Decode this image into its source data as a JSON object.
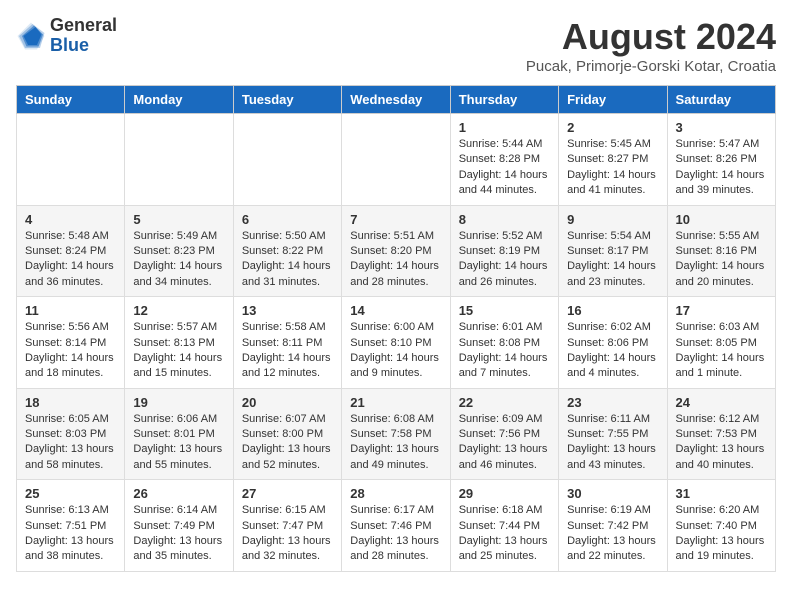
{
  "logo": {
    "general": "General",
    "blue": "Blue"
  },
  "title": "August 2024",
  "subtitle": "Pucak, Primorje-Gorski Kotar, Croatia",
  "headers": [
    "Sunday",
    "Monday",
    "Tuesday",
    "Wednesday",
    "Thursday",
    "Friday",
    "Saturday"
  ],
  "weeks": [
    [
      {
        "day": "",
        "info": ""
      },
      {
        "day": "",
        "info": ""
      },
      {
        "day": "",
        "info": ""
      },
      {
        "day": "",
        "info": ""
      },
      {
        "day": "1",
        "info": "Sunrise: 5:44 AM\nSunset: 8:28 PM\nDaylight: 14 hours and 44 minutes."
      },
      {
        "day": "2",
        "info": "Sunrise: 5:45 AM\nSunset: 8:27 PM\nDaylight: 14 hours and 41 minutes."
      },
      {
        "day": "3",
        "info": "Sunrise: 5:47 AM\nSunset: 8:26 PM\nDaylight: 14 hours and 39 minutes."
      }
    ],
    [
      {
        "day": "4",
        "info": "Sunrise: 5:48 AM\nSunset: 8:24 PM\nDaylight: 14 hours and 36 minutes."
      },
      {
        "day": "5",
        "info": "Sunrise: 5:49 AM\nSunset: 8:23 PM\nDaylight: 14 hours and 34 minutes."
      },
      {
        "day": "6",
        "info": "Sunrise: 5:50 AM\nSunset: 8:22 PM\nDaylight: 14 hours and 31 minutes."
      },
      {
        "day": "7",
        "info": "Sunrise: 5:51 AM\nSunset: 8:20 PM\nDaylight: 14 hours and 28 minutes."
      },
      {
        "day": "8",
        "info": "Sunrise: 5:52 AM\nSunset: 8:19 PM\nDaylight: 14 hours and 26 minutes."
      },
      {
        "day": "9",
        "info": "Sunrise: 5:54 AM\nSunset: 8:17 PM\nDaylight: 14 hours and 23 minutes."
      },
      {
        "day": "10",
        "info": "Sunrise: 5:55 AM\nSunset: 8:16 PM\nDaylight: 14 hours and 20 minutes."
      }
    ],
    [
      {
        "day": "11",
        "info": "Sunrise: 5:56 AM\nSunset: 8:14 PM\nDaylight: 14 hours and 18 minutes."
      },
      {
        "day": "12",
        "info": "Sunrise: 5:57 AM\nSunset: 8:13 PM\nDaylight: 14 hours and 15 minutes."
      },
      {
        "day": "13",
        "info": "Sunrise: 5:58 AM\nSunset: 8:11 PM\nDaylight: 14 hours and 12 minutes."
      },
      {
        "day": "14",
        "info": "Sunrise: 6:00 AM\nSunset: 8:10 PM\nDaylight: 14 hours and 9 minutes."
      },
      {
        "day": "15",
        "info": "Sunrise: 6:01 AM\nSunset: 8:08 PM\nDaylight: 14 hours and 7 minutes."
      },
      {
        "day": "16",
        "info": "Sunrise: 6:02 AM\nSunset: 8:06 PM\nDaylight: 14 hours and 4 minutes."
      },
      {
        "day": "17",
        "info": "Sunrise: 6:03 AM\nSunset: 8:05 PM\nDaylight: 14 hours and 1 minute."
      }
    ],
    [
      {
        "day": "18",
        "info": "Sunrise: 6:05 AM\nSunset: 8:03 PM\nDaylight: 13 hours and 58 minutes."
      },
      {
        "day": "19",
        "info": "Sunrise: 6:06 AM\nSunset: 8:01 PM\nDaylight: 13 hours and 55 minutes."
      },
      {
        "day": "20",
        "info": "Sunrise: 6:07 AM\nSunset: 8:00 PM\nDaylight: 13 hours and 52 minutes."
      },
      {
        "day": "21",
        "info": "Sunrise: 6:08 AM\nSunset: 7:58 PM\nDaylight: 13 hours and 49 minutes."
      },
      {
        "day": "22",
        "info": "Sunrise: 6:09 AM\nSunset: 7:56 PM\nDaylight: 13 hours and 46 minutes."
      },
      {
        "day": "23",
        "info": "Sunrise: 6:11 AM\nSunset: 7:55 PM\nDaylight: 13 hours and 43 minutes."
      },
      {
        "day": "24",
        "info": "Sunrise: 6:12 AM\nSunset: 7:53 PM\nDaylight: 13 hours and 40 minutes."
      }
    ],
    [
      {
        "day": "25",
        "info": "Sunrise: 6:13 AM\nSunset: 7:51 PM\nDaylight: 13 hours and 38 minutes."
      },
      {
        "day": "26",
        "info": "Sunrise: 6:14 AM\nSunset: 7:49 PM\nDaylight: 13 hours and 35 minutes."
      },
      {
        "day": "27",
        "info": "Sunrise: 6:15 AM\nSunset: 7:47 PM\nDaylight: 13 hours and 32 minutes."
      },
      {
        "day": "28",
        "info": "Sunrise: 6:17 AM\nSunset: 7:46 PM\nDaylight: 13 hours and 28 minutes."
      },
      {
        "day": "29",
        "info": "Sunrise: 6:18 AM\nSunset: 7:44 PM\nDaylight: 13 hours and 25 minutes."
      },
      {
        "day": "30",
        "info": "Sunrise: 6:19 AM\nSunset: 7:42 PM\nDaylight: 13 hours and 22 minutes."
      },
      {
        "day": "31",
        "info": "Sunrise: 6:20 AM\nSunset: 7:40 PM\nDaylight: 13 hours and 19 minutes."
      }
    ]
  ]
}
